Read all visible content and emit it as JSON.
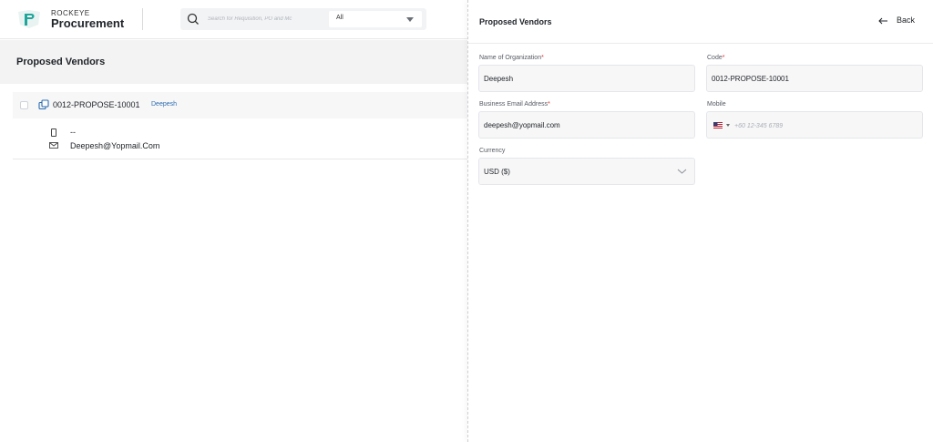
{
  "brand": {
    "small": "ROCKEYE",
    "big": "Procurement"
  },
  "search": {
    "placeholder": "Search for Requisition, PO and Mc",
    "filter_value": "All"
  },
  "page": {
    "title": "Proposed Vendors"
  },
  "list": {
    "rows": [
      {
        "code": "0012-PROPOSE-10001",
        "name": "Deepesh",
        "phone": "--",
        "email": "Deepesh@Yopmail.Com"
      }
    ]
  },
  "drawer": {
    "title": "Proposed Vendors",
    "back_label": "Back",
    "form": {
      "org_name": {
        "label": "Name of Organization",
        "required_mark": "*",
        "value": "Deepesh"
      },
      "code": {
        "label": "Code",
        "required_mark": "*",
        "value": "0012-PROPOSE-10001"
      },
      "email": {
        "label": "Business Email Address",
        "required_mark": "*",
        "value": "deepesh@yopmail.com"
      },
      "mobile": {
        "label": "Mobile",
        "placeholder": "+60 12-345 6789",
        "country_icon": "us-flag-icon"
      },
      "currency": {
        "label": "Currency",
        "value": "USD ($)"
      }
    }
  },
  "colors": {
    "link": "#2b6cb0",
    "required": "#e03131",
    "accent_teal": "#1fa59a"
  }
}
